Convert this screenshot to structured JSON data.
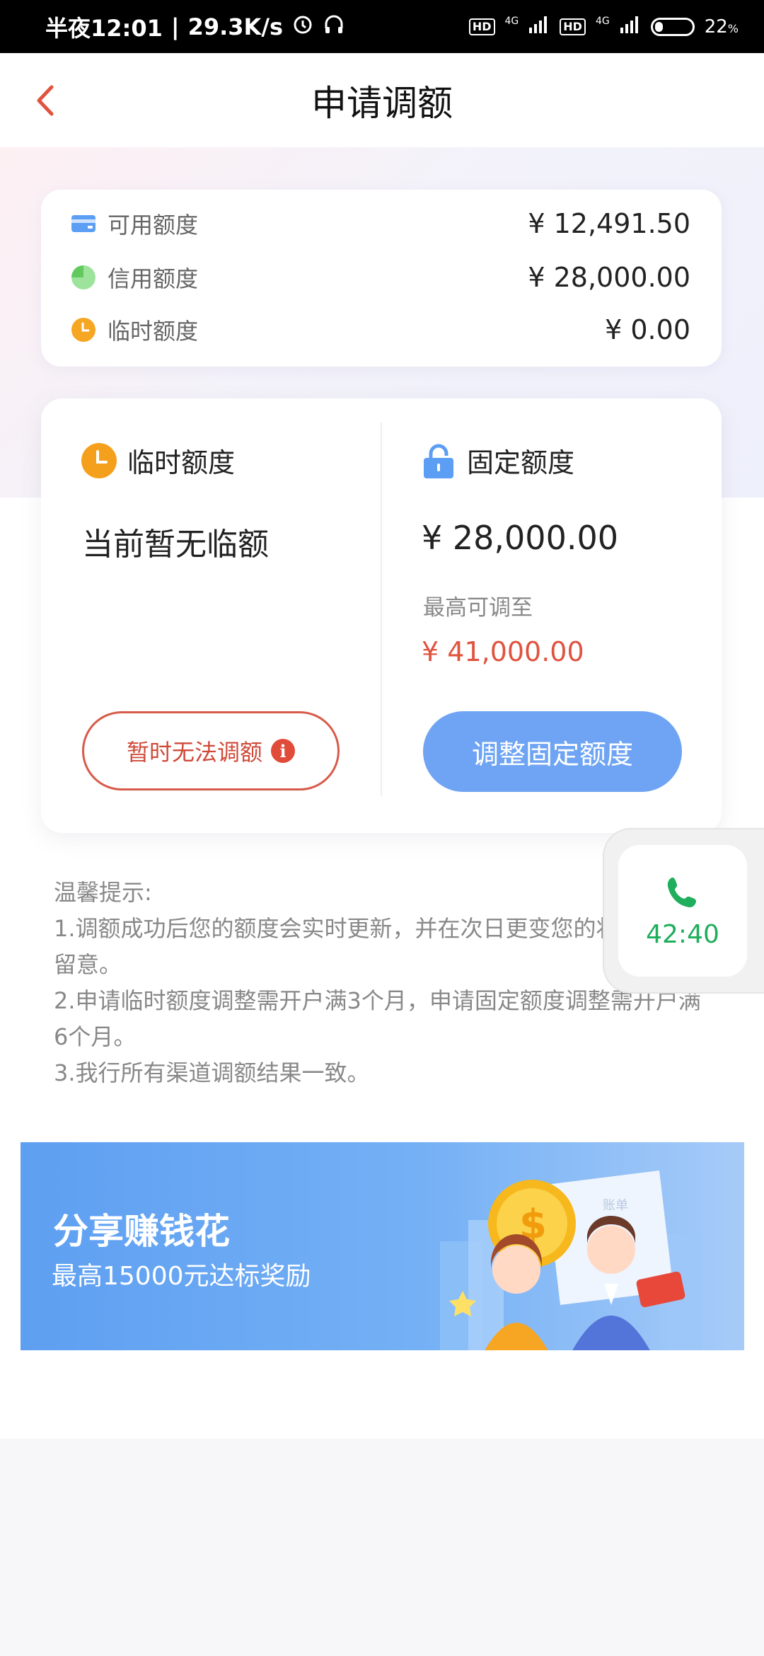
{
  "status_bar": {
    "time": "半夜12:01",
    "speed": "29.3K/s",
    "hd1": "HD",
    "net1": "4G",
    "hd2": "HD",
    "net2": "4G",
    "battery": "22",
    "battery_unit": "%"
  },
  "header": {
    "title": "申请调额"
  },
  "summary": [
    {
      "label": "可用额度",
      "value": "¥ 12,491.50",
      "icon": "card-icon"
    },
    {
      "label": "信用额度",
      "value": "¥ 28,000.00",
      "icon": "pie-chart-icon"
    },
    {
      "label": "临时额度",
      "value": "¥ 0.00",
      "icon": "clock-icon"
    }
  ],
  "temp_limit": {
    "title": "临时额度",
    "status": "当前暂无临额",
    "button_label": "暂时无法调额",
    "info_glyph": "i"
  },
  "fixed_limit": {
    "title": "固定额度",
    "amount": "¥ 28,000.00",
    "max_label": "最高可调至",
    "max_amount": "¥ 41,000.00",
    "button_label": "调整固定额度"
  },
  "tips": {
    "heading": "温馨提示:",
    "lines": [
      "1.调额成功后您的额度会实时更新，并在次日更变您的状态，敬请留意。",
      "2.申请临时额度调整需开户满3个月，申请固定额度调整需开户满6个月。",
      "3.我行所有渠道调额结果一致。"
    ]
  },
  "call_widget": {
    "timer": "42:40"
  },
  "banner": {
    "title": "分享赚钱花",
    "subtitle": "最高15000元达标奖励",
    "coin_glyph": "$",
    "paper_text": "账单"
  },
  "colors": {
    "accent_red": "#e0533f",
    "button_blue": "#6ea4f3",
    "call_green": "#1fae5b"
  }
}
